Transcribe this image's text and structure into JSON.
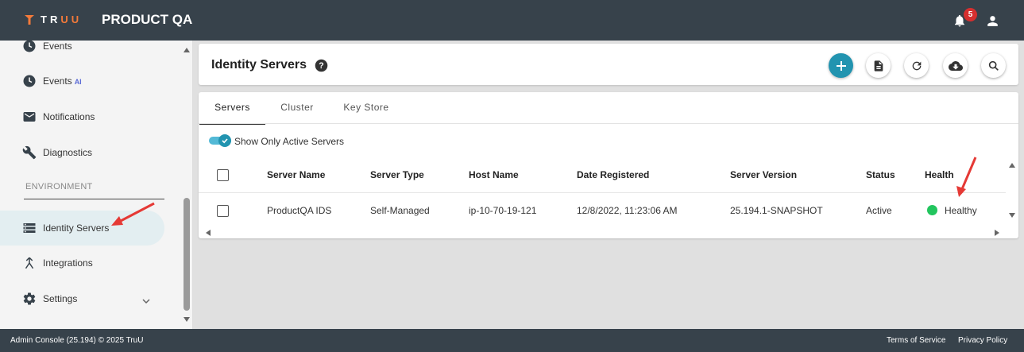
{
  "topbar": {
    "logo_text": "TRUU",
    "app_title": "PRODUCT QA",
    "notification_count": "5"
  },
  "sidebar": {
    "items": [
      {
        "label": "Events"
      },
      {
        "label": "Events",
        "tag": "AI"
      },
      {
        "label": "Notifications"
      },
      {
        "label": "Diagnostics"
      },
      {
        "label": "Identity Servers",
        "active": true
      },
      {
        "label": "Integrations"
      },
      {
        "label": "Settings"
      }
    ],
    "section_label": "ENVIRONMENT"
  },
  "page": {
    "title": "Identity Servers"
  },
  "tabs": [
    {
      "label": "Servers",
      "active": true
    },
    {
      "label": "Cluster"
    },
    {
      "label": "Key Store"
    }
  ],
  "filter": {
    "label": "Show Only Active Servers",
    "checked": true
  },
  "table": {
    "columns": [
      "Server Name",
      "Server Type",
      "Host Name",
      "Date Registered",
      "Server Version",
      "Status",
      "Health"
    ],
    "rows": [
      {
        "server_name": "ProductQA IDS",
        "server_type": "Self-Managed",
        "host_name": "ip-10-70-19-121",
        "date_registered": "12/8/2022, 11:23:06 AM",
        "server_version": "25.194.1-SNAPSHOT",
        "status": "Active",
        "health": "Healthy"
      }
    ]
  },
  "footer": {
    "copyright": "Admin Console (25.194) © 2025 TruU",
    "terms": "Terms of Service",
    "privacy": "Privacy Policy"
  },
  "colors": {
    "header_bg": "#37424b",
    "accent": "#2294b0",
    "healthy": "#22c55e",
    "badge": "#d62f2f",
    "annotation_arrow": "#e53935"
  }
}
